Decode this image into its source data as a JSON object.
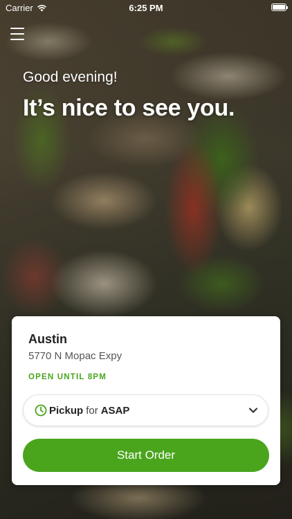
{
  "status_bar": {
    "carrier": "Carrier",
    "time": "6:25 PM"
  },
  "header": {
    "menu_icon": "hamburger-menu-icon"
  },
  "greeting": {
    "salutation": "Good evening!",
    "headline": "It’s nice to see you."
  },
  "location_card": {
    "store_name": "Austin",
    "address": "5770 N Mopac Expy",
    "hours": "OPEN UNTIL 8PM",
    "order_type": {
      "mode": "Pickup",
      "connector": "for",
      "time": "ASAP",
      "icon": "clock-icon",
      "dropdown_icon": "chevron-down-icon"
    },
    "start_button": "Start Order"
  },
  "colors": {
    "accent": "#4aa51d",
    "card_bg": "#ffffff",
    "text_primary": "#222222",
    "text_secondary": "#555555"
  }
}
